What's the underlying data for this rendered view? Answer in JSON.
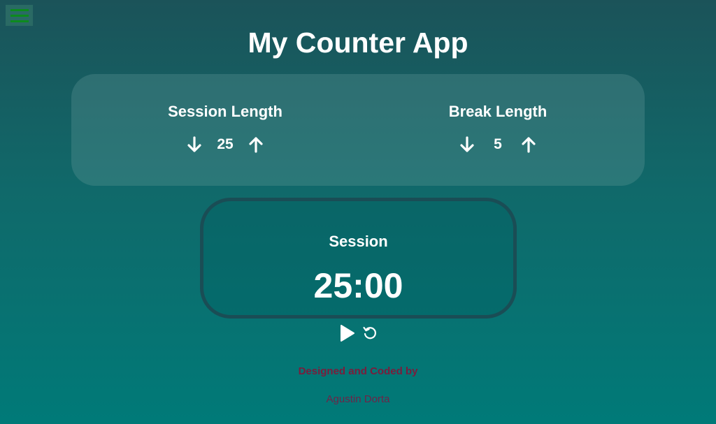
{
  "header": {
    "title": "My Counter App"
  },
  "settings": {
    "session": {
      "label": "Session Length",
      "value": "25"
    },
    "break": {
      "label": "Break Length",
      "value": "5"
    }
  },
  "timer": {
    "label": "Session",
    "time": "25:00"
  },
  "footer": {
    "line1": "Designed and Coded by",
    "line2": "Agustin Dorta"
  },
  "icons": {
    "menu": "hamburger-icon",
    "decrement": "arrow-down-icon",
    "increment": "arrow-up-icon",
    "play": "play-icon",
    "reset": "reset-icon"
  },
  "colors": {
    "menu_bars": "#0c8a1e",
    "credit_text": "#7a1d3c",
    "timer_border": "#1a4d55"
  }
}
